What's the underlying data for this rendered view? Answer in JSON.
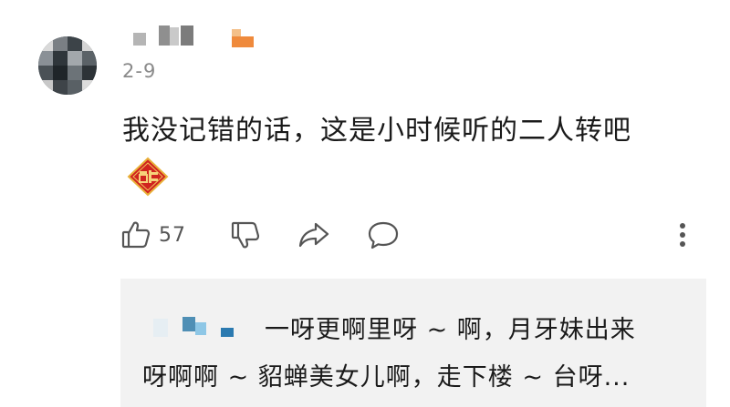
{
  "comment": {
    "date": "2-9",
    "text": "我没记错的话，这是小时候听的二人转吧",
    "emoji": "fu-sticker-icon",
    "like_count": "57"
  },
  "actions": {
    "like_icon": "thumbs-up-icon",
    "dislike_icon": "thumbs-down-icon",
    "share_icon": "share-icon",
    "reply_icon": "comment-bubble-icon",
    "more_icon": "more-vertical-icon"
  },
  "reply": {
    "line1": "一呀更啊里呀 ~ 啊，月牙妹出来",
    "line2": "呀啊啊 ~ 貂蝉美女儿啊，走下楼 ~ 台呀..."
  },
  "colors": {
    "accent_red": "#d0241f",
    "gold": "#e9b13a",
    "text_primary": "#1a1a1a",
    "text_secondary": "#8a8a8a",
    "reply_bg": "#f2f2f2"
  }
}
